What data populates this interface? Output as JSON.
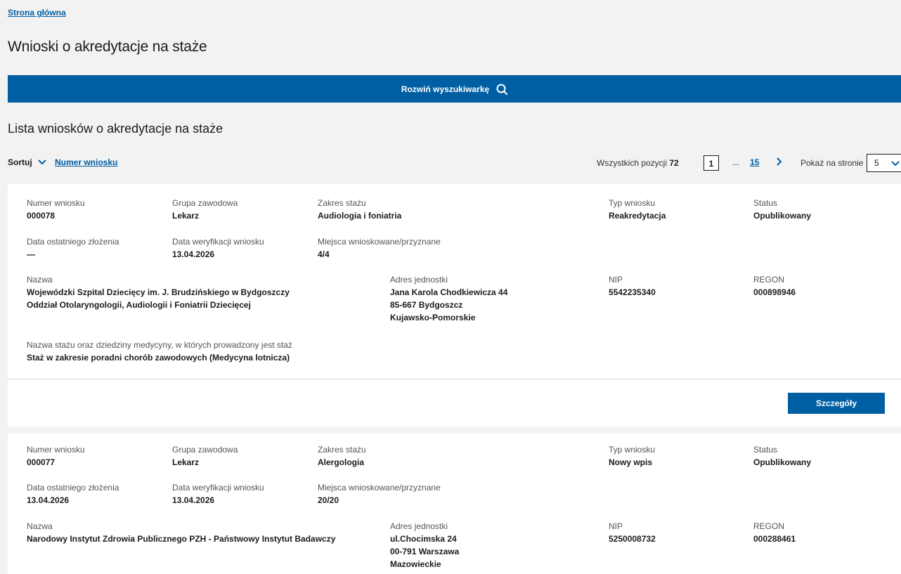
{
  "breadcrumb": {
    "home": "Strona główna"
  },
  "page_title": "Wnioski o akredytacje na staże",
  "search_toggle": {
    "label": "Rozwiń wyszukiwarkę"
  },
  "list_title": "Lista wniosków o akredytacje na staże",
  "sort": {
    "label": "Sortuj",
    "field": "Numer wniosku"
  },
  "pagination": {
    "total_label": "Wszystkich pozycji",
    "total_value": "72",
    "current_page": "1",
    "ellipsis": "...",
    "last_page": "15",
    "per_page_label": "Pokaż na stronie",
    "per_page_value": "5"
  },
  "labels": {
    "numer": "Numer wniosku",
    "grupa": "Grupa zawodowa",
    "zakres": "Zakres stażu",
    "typ": "Typ wniosku",
    "status": "Status",
    "data_zlozenia": "Data ostatniego złożenia",
    "data_weryfikacji": "Data weryfikacji wniosku",
    "miejsca": "Miejsca wnioskowane/przyznane",
    "nazwa": "Nazwa",
    "adres": "Adres jednostki",
    "nip": "NIP",
    "regon": "REGON",
    "dziedziny": "Nazwa stażu oraz dziedziny medycyny, w których prowadzony jest staż",
    "details_button": "Szczegóły"
  },
  "items": [
    {
      "numer": "000078",
      "grupa": "Lekarz",
      "zakres": "Audiologia i foniatria",
      "typ": "Reakredytacja",
      "status": "Opublikowany",
      "data_zlozenia": "—",
      "data_weryfikacji": "13.04.2026",
      "miejsca": "4/4",
      "nazwa_line1": "Wojewódzki Szpital Dziecięcy im. J. Brudzińskiego w Bydgoszczy",
      "nazwa_line2": "Oddział Otolaryngologii, Audiologii i Foniatrii Dziecięcej",
      "adres_line1": "Jana Karola Chodkiewicza 44",
      "adres_line2": "85-667 Bydgoszcz",
      "adres_line3": "Kujawsko-Pomorskie",
      "nip": "5542235340",
      "regon": "000898946",
      "dziedziny": "Staż w zakresie poradni chorób zawodowych (Medycyna lotnicza)"
    },
    {
      "numer": "000077",
      "grupa": "Lekarz",
      "zakres": "Alergologia",
      "typ": "Nowy wpis",
      "status": "Opublikowany",
      "data_zlozenia": "13.04.2026",
      "data_weryfikacji": "13.04.2026",
      "miejsca": "20/20",
      "nazwa_line1": "Narodowy Instytut Zdrowia Publicznego PZH - Państwowy Instytut Badawczy",
      "adres_line1": "ul.Chocimska 24",
      "adres_line2": "00-791 Warszawa",
      "adres_line3": "Mazowieckie",
      "nip": "5250008732",
      "regon": "000288461"
    }
  ]
}
